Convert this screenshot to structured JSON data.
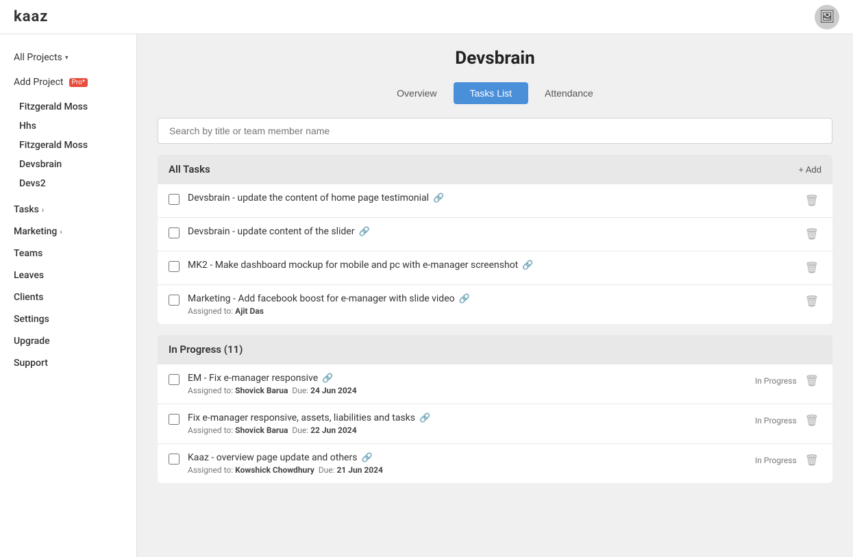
{
  "header": {
    "logo": "kaaz",
    "avatar_label": "👤"
  },
  "sidebar": {
    "all_projects_label": "All Projects",
    "add_project_label": "Add Project",
    "add_project_badge": "Pro*",
    "projects": [
      {
        "id": "fitzgerald-moss-1",
        "label": "Fitzgerald Moss"
      },
      {
        "id": "hhs",
        "label": "Hhs"
      },
      {
        "id": "fitzgerald-moss-2",
        "label": "Fitzgerald Moss"
      },
      {
        "id": "devsbrain",
        "label": "Devsbrain"
      },
      {
        "id": "devs2",
        "label": "Devs2"
      }
    ],
    "nav_items": [
      {
        "id": "tasks",
        "label": "Tasks",
        "has_arrow": true
      },
      {
        "id": "marketing",
        "label": "Marketing",
        "has_arrow": true
      },
      {
        "id": "teams",
        "label": "Teams",
        "has_arrow": false
      },
      {
        "id": "leaves",
        "label": "Leaves",
        "has_arrow": false
      },
      {
        "id": "clients",
        "label": "Clients",
        "has_arrow": false
      },
      {
        "id": "settings",
        "label": "Settings",
        "has_arrow": false
      },
      {
        "id": "upgrade",
        "label": "Upgrade",
        "has_arrow": false
      },
      {
        "id": "support",
        "label": "Support",
        "has_arrow": false
      }
    ]
  },
  "main": {
    "page_title": "Devsbrain",
    "tabs": [
      {
        "id": "overview",
        "label": "Overview",
        "active": false
      },
      {
        "id": "tasks-list",
        "label": "Tasks List",
        "active": true
      },
      {
        "id": "attendance",
        "label": "Attendance",
        "active": false
      }
    ],
    "search_placeholder": "Search by title or team member name",
    "all_tasks_section": {
      "header": "All Tasks",
      "add_label": "+ Add",
      "tasks": [
        {
          "id": "task-1",
          "title": "Devsbrain - update the content of home page testimonial",
          "has_link": true,
          "meta": null
        },
        {
          "id": "task-2",
          "title": "Devsbrain - update content of the slider",
          "has_link": true,
          "meta": null
        },
        {
          "id": "task-3",
          "title": "MK2 - Make dashboard mockup for mobile and pc with e-manager screenshot",
          "has_link": true,
          "meta": null
        },
        {
          "id": "task-4",
          "title": "Marketing - Add facebook boost for e-manager with slide video",
          "has_link": true,
          "meta": "Assigned to: Ajit Das"
        }
      ]
    },
    "in_progress_section": {
      "header": "In Progress (11)",
      "tasks": [
        {
          "id": "ip-task-1",
          "title": "EM - Fix e-manager responsive",
          "has_link": true,
          "status": "In Progress",
          "meta": "Assigned to: Shovick Barua  Due: 24 Jun 2024",
          "meta_bold": "Shovick Barua",
          "due_bold": "24 Jun 2024"
        },
        {
          "id": "ip-task-2",
          "title": "Fix e-manager responsive, assets, liabilities and tasks",
          "has_link": true,
          "status": "In Progress",
          "meta": "Assigned to: Shovick Barua  Due: 22 Jun 2024",
          "meta_bold": "Shovick Barua",
          "due_bold": "22 Jun 2024"
        },
        {
          "id": "ip-task-3",
          "title": "Kaaz - overview page update and others",
          "has_link": true,
          "status": "In Progress",
          "meta": "Assigned to: Kowshick Chowdhury  Due: 21 Jun 2024",
          "meta_bold": "Kowshick Chowdhury",
          "due_bold": "21 Jun 2024"
        }
      ]
    }
  }
}
